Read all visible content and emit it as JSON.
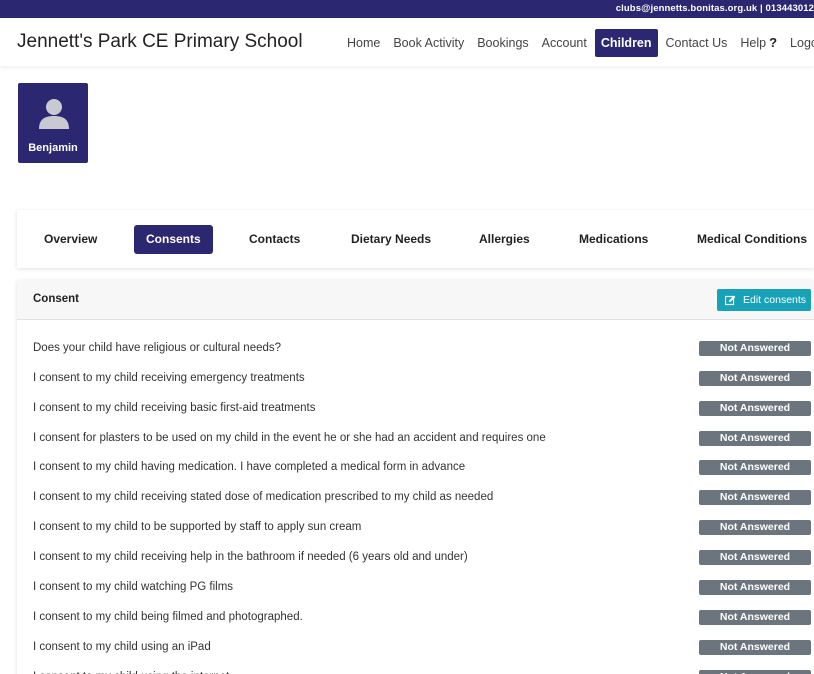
{
  "topbar": {
    "email": "clubs@jennetts.bonitas.org.uk",
    "separator": "|",
    "phone": "013443012"
  },
  "header": {
    "brand": "Jennett's Park CE Primary School"
  },
  "nav": {
    "items": [
      {
        "label": "Home"
      },
      {
        "label": "Book Activity"
      },
      {
        "label": "Bookings"
      },
      {
        "label": "Account"
      },
      {
        "label": "Children",
        "active": true
      },
      {
        "label": "Contact Us"
      },
      {
        "label": "Help"
      },
      {
        "label": "Logout"
      }
    ]
  },
  "child": {
    "name": "Benjamin"
  },
  "tabs": {
    "items": [
      {
        "label": "Overview"
      },
      {
        "label": "Consents",
        "active": true
      },
      {
        "label": "Contacts"
      },
      {
        "label": "Dietary Needs"
      },
      {
        "label": "Allergies"
      },
      {
        "label": "Medications"
      },
      {
        "label": "Medical Conditions"
      }
    ]
  },
  "consent": {
    "title": "Consent",
    "edit_label": "Edit consents",
    "rows": [
      {
        "question": "Does your child have religious or cultural needs?",
        "status": "Not Answered"
      },
      {
        "question": "I consent to my child receiving emergency treatments",
        "status": "Not Answered"
      },
      {
        "question": "I consent to my child receiving basic first-aid treatments",
        "status": "Not Answered"
      },
      {
        "question": "I consent for plasters to be used on my child in the event he or she had an accident and requires one",
        "status": "Not Answered"
      },
      {
        "question": "I consent to my child having medication. I have completed a medical form in advance",
        "status": "Not Answered"
      },
      {
        "question": "I consent to my child receiving stated dose of medication prescribed to my child as needed",
        "status": "Not Answered"
      },
      {
        "question": "I consent to my child to be supported by staff to apply sun cream",
        "status": "Not Answered"
      },
      {
        "question": "I consent to my child receiving help in the bathroom if needed (6 years old and under)",
        "status": "Not Answered"
      },
      {
        "question": "I consent to my child watching PG films",
        "status": "Not Answered"
      },
      {
        "question": "I consent to my child being filmed and photographed.",
        "status": "Not Answered"
      },
      {
        "question": "I consent to my child using an iPad",
        "status": "Not Answered"
      },
      {
        "question": "I consent to my child using the internet",
        "status": "Not Answered"
      }
    ]
  },
  "colors": {
    "primary": "#2b2770",
    "info": "#17a2b8",
    "badge": "#6c757d"
  },
  "icons": {
    "avatar": "user-silhouette-icon",
    "edit": "pencil-square-icon",
    "help": "question-mark-icon"
  }
}
